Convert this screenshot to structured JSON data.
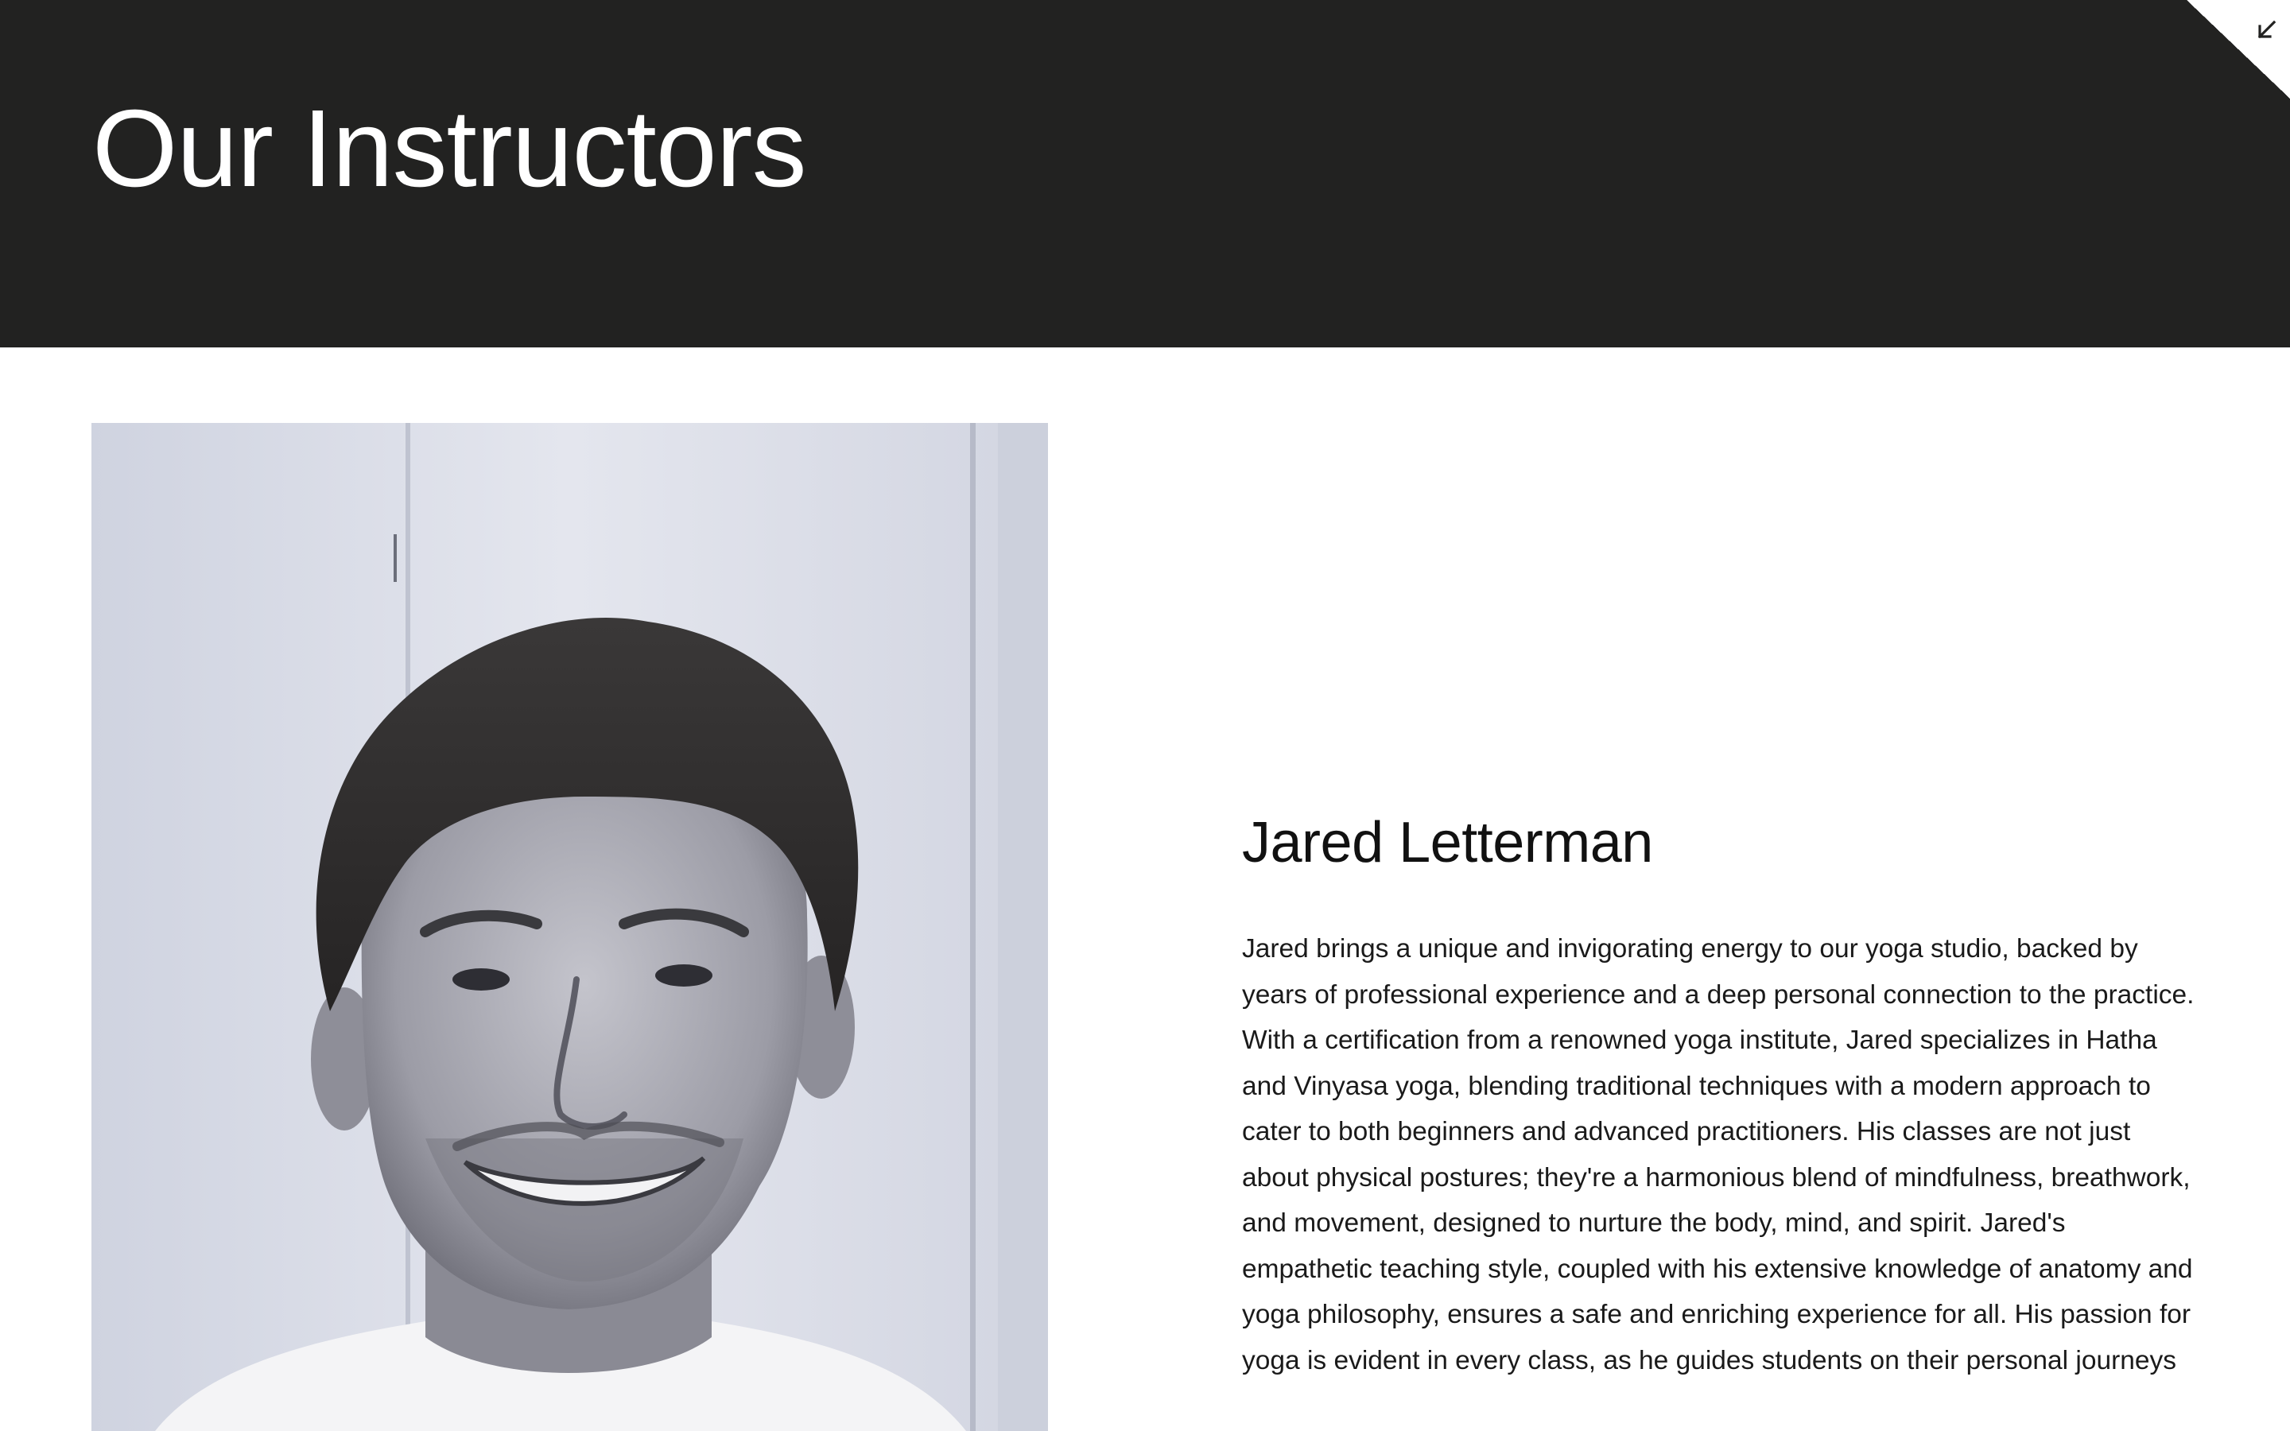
{
  "page": {
    "title": "Our Instructors"
  },
  "corner_action": {
    "icon": "arrow-down-left-icon"
  },
  "instructor": {
    "name": "Jared Letterman",
    "bio": "Jared brings a unique and invigorating energy to our yoga studio, backed by years of professional experience and a deep personal connection to the practice. With a certification from a renowned yoga institute, Jared specializes in Hatha and Vinyasa yoga, blending traditional techniques with a modern approach to cater to both beginners and advanced practitioners. His classes are not just about physical postures; they're a harmonious blend of mindfulness, breathwork, and movement, designed to nurture the body, mind, and spirit. Jared's empathetic teaching style, coupled with his extensive knowledge of anatomy and yoga philosophy, ensures a safe and enriching experience for all. His passion for yoga is evident in every class, as he guides students on their personal journeys",
    "photo_alt": "Jared Letterman portrait"
  },
  "colors": {
    "header_bg": "#222221",
    "header_text": "#ffffff",
    "body_bg": "#ffffff",
    "body_text": "#1a1a1a"
  }
}
